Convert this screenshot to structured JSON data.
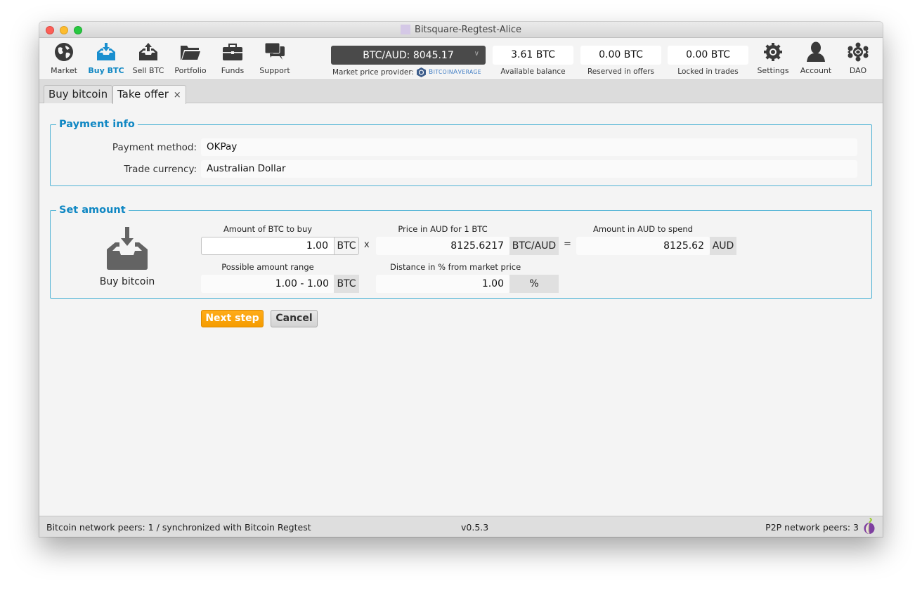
{
  "window": {
    "title": "Bitsquare-Regtest-Alice"
  },
  "nav": {
    "items": [
      {
        "id": "market",
        "label": "Market",
        "icon": "globe-icon"
      },
      {
        "id": "buy",
        "label": "Buy BTC",
        "icon": "inbox-download-icon",
        "active": true
      },
      {
        "id": "sell",
        "label": "Sell BTC",
        "icon": "inbox-upload-icon"
      },
      {
        "id": "portfolio",
        "label": "Portfolio",
        "icon": "folder-icon"
      },
      {
        "id": "funds",
        "label": "Funds",
        "icon": "briefcase-icon"
      },
      {
        "id": "support",
        "label": "Support",
        "icon": "chat-bubbles-icon"
      }
    ],
    "right_items": [
      {
        "id": "settings",
        "label": "Settings",
        "icon": "gear-icon"
      },
      {
        "id": "account",
        "label": "Account",
        "icon": "user-icon"
      },
      {
        "id": "dao",
        "label": "DAO",
        "icon": "dao-network-icon"
      }
    ],
    "market_price": "BTC/AUD: 8045.17",
    "price_provider_label": "Market price provider:",
    "price_provider_name": "BitcoinAverage",
    "balances": [
      {
        "value": "3.61 BTC",
        "caption": "Available balance"
      },
      {
        "value": "0.00 BTC",
        "caption": "Reserved in offers"
      },
      {
        "value": "0.00 BTC",
        "caption": "Locked in trades"
      }
    ]
  },
  "tabs": [
    {
      "label": "Buy bitcoin",
      "active": false
    },
    {
      "label": "Take offer",
      "active": true,
      "close": "×"
    }
  ],
  "payment_info": {
    "title": "Payment info",
    "method_label": "Payment method:",
    "method_value": "OKPay",
    "currency_label": "Trade currency:",
    "currency_value": "Australian Dollar"
  },
  "set_amount": {
    "title": "Set amount",
    "icon_caption": "Buy bitcoin",
    "amount_label": "Amount of BTC to buy",
    "amount_value": "1.00",
    "amount_unit": "BTC",
    "multiply": "x",
    "price_label": "Price in AUD for 1 BTC",
    "price_value": "8125.6217",
    "price_unit": "BTC/AUD",
    "equals": "=",
    "total_label": "Amount in AUD to spend",
    "total_value": "8125.62",
    "total_unit": "AUD",
    "range_label": "Possible amount range",
    "range_value": "1.00 - 1.00",
    "range_unit": "BTC",
    "distance_label": "Distance in % from market price",
    "distance_value": "1.00",
    "distance_unit": "%"
  },
  "buttons": {
    "next": "Next step",
    "cancel": "Cancel"
  },
  "status": {
    "bitcoin": "Bitcoin network peers: 1 / synchronized with Bitcoin Regtest",
    "version": "v0.5.3",
    "p2p": "P2P network peers: 3"
  },
  "colors": {
    "accent": "#0f87c3",
    "primary_button": "#f8a100",
    "fieldset_border": "#4fb3d5"
  }
}
